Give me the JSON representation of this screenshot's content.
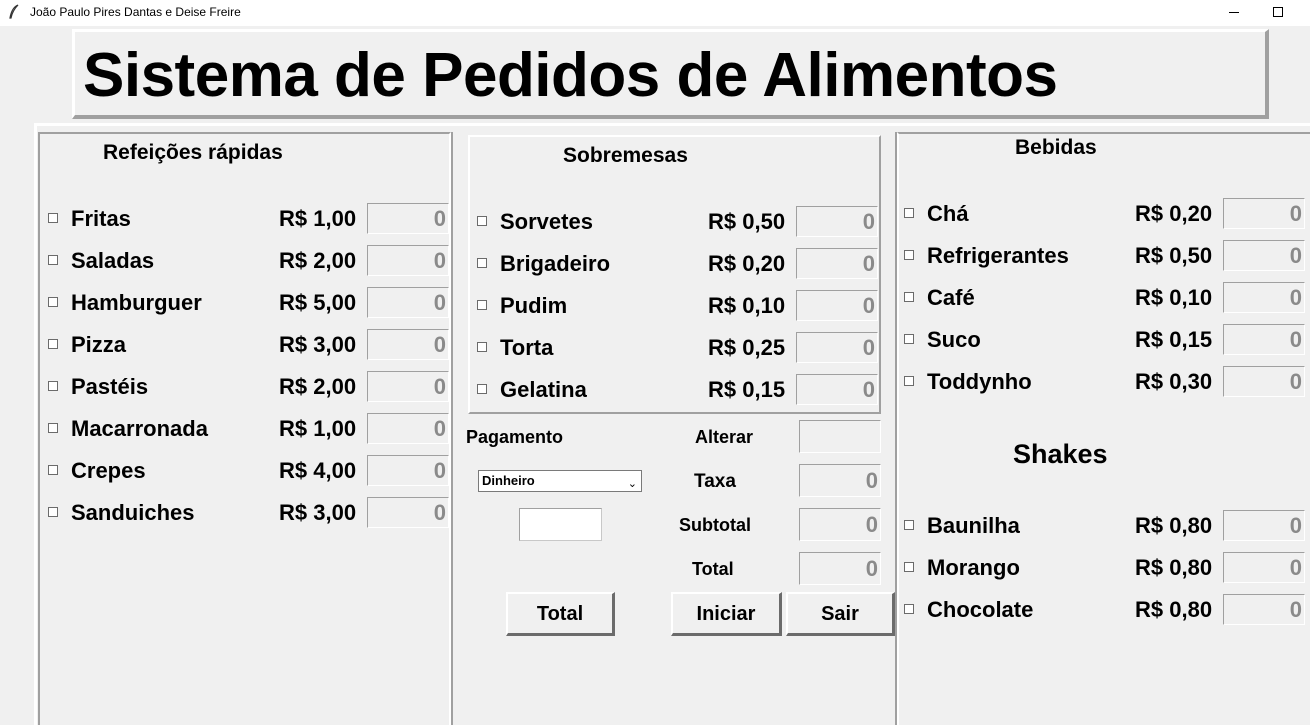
{
  "window": {
    "title": "João Paulo Pires Dantas e Deise Freire"
  },
  "header": {
    "title": "Sistema de Pedidos de Alimentos"
  },
  "fast_food": {
    "title": "Refeições rápidas",
    "items": [
      {
        "name": "Fritas",
        "price": "R$ 1,00",
        "qty": "0"
      },
      {
        "name": "Saladas",
        "price": "R$ 2,00",
        "qty": "0"
      },
      {
        "name": "Hamburguer",
        "price": "R$ 5,00",
        "qty": "0"
      },
      {
        "name": "Pizza",
        "price": "R$ 3,00",
        "qty": "0"
      },
      {
        "name": "Pastéis",
        "price": "R$ 2,00",
        "qty": "0"
      },
      {
        "name": "Macarronada",
        "price": "R$ 1,00",
        "qty": "0"
      },
      {
        "name": "Crepes",
        "price": "R$ 4,00",
        "qty": "0"
      },
      {
        "name": "Sanduiches",
        "price": "R$ 3,00",
        "qty": "0"
      }
    ]
  },
  "desserts": {
    "title": "Sobremesas",
    "items": [
      {
        "name": "Sorvetes",
        "price": "R$ 0,50",
        "qty": "0"
      },
      {
        "name": "Brigadeiro",
        "price": "R$ 0,20",
        "qty": "0"
      },
      {
        "name": "Pudim",
        "price": "R$ 0,10",
        "qty": "0"
      },
      {
        "name": "Torta",
        "price": "R$ 0,25",
        "qty": "0"
      },
      {
        "name": "Gelatina",
        "price": "R$ 0,15",
        "qty": "0"
      }
    ]
  },
  "drinks": {
    "title": "Bebidas",
    "items": [
      {
        "name": "Chá",
        "price": "R$ 0,20",
        "qty": "0"
      },
      {
        "name": "Refrigerantes",
        "price": "R$ 0,50",
        "qty": "0"
      },
      {
        "name": "Café",
        "price": "R$ 0,10",
        "qty": "0"
      },
      {
        "name": "Suco",
        "price": "R$ 0,15",
        "qty": "0"
      },
      {
        "name": "Toddynho",
        "price": "R$ 0,30",
        "qty": "0"
      }
    ]
  },
  "shakes": {
    "title": "Shakes",
    "items": [
      {
        "name": "Baunilha",
        "price": "R$ 0,80",
        "qty": "0"
      },
      {
        "name": "Morango",
        "price": "R$ 0,80",
        "qty": "0"
      },
      {
        "name": "Chocolate",
        "price": "R$ 0,80",
        "qty": "0"
      }
    ]
  },
  "payment": {
    "label": "Pagamento",
    "method": "Dinheiro",
    "cash_value": "",
    "change_label": "Alterar",
    "change_value": "",
    "tax_label": "Taxa",
    "tax_value": "0",
    "subtotal_label": "Subtotal",
    "subtotal_value": "0",
    "total_label": "Total",
    "total_value": "0"
  },
  "buttons": {
    "total": "Total",
    "start": "Iniciar",
    "exit": "Sair"
  }
}
